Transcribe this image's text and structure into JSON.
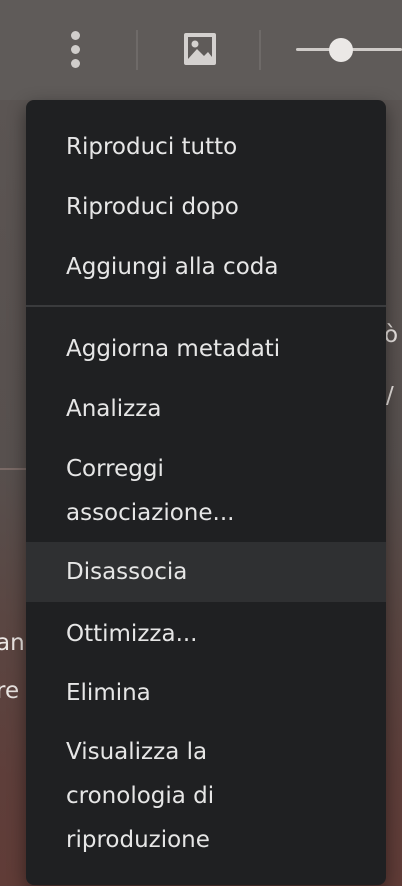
{
  "toolbar": {
    "icons": [
      "more-vertical-icon",
      "image-icon"
    ],
    "volume_level": 0.4
  },
  "background_fragments": {
    "right_top": "ò",
    "right_bottom": "/",
    "left_top": "an",
    "left_bottom": "re"
  },
  "menu": {
    "items": [
      {
        "label": "Riproduci tutto"
      },
      {
        "label": "Riproduci dopo"
      },
      {
        "label": "Aggiungi alla coda"
      },
      {
        "label": "Aggiorna metadati"
      },
      {
        "label": "Analizza"
      },
      {
        "label": "Correggi\nassociazione..."
      },
      {
        "label": "Disassocia",
        "selected": true
      },
      {
        "label": "Ottimizza..."
      },
      {
        "label": "Elimina"
      },
      {
        "label": "Visualizza la\ncronologia di\nriproduzione"
      }
    ]
  },
  "colors": {
    "menu_background": "#1f2022",
    "menu_selected": "#2f3032",
    "menu_text": "#e6e6e6"
  }
}
